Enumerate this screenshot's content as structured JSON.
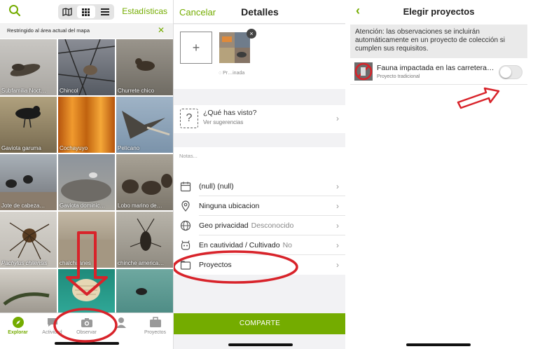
{
  "explore": {
    "stats_link": "Estadísticas",
    "restrict_text": "Restringido al área actual del mapa",
    "tiles": [
      "Subfamilia Noct…",
      "Chincol",
      "Churrete chico",
      "Gaviota garuma",
      "Cochayuyo",
      "Pelícano",
      "Jote de cabeza…",
      "Gaviota dominic…",
      "Lobo marino de…",
      "Pachylus chilensis",
      "chalchuanes",
      "chinche america…",
      "",
      "",
      ""
    ],
    "nav": [
      {
        "label": "Explorar",
        "icon": "explore-icon"
      },
      {
        "label": "Actividad",
        "icon": "activity-icon"
      },
      {
        "label": "Observar",
        "icon": "camera-icon"
      },
      {
        "label": "",
        "icon": "user-icon"
      },
      {
        "label": "Proyectos",
        "icon": "briefcase-icon"
      }
    ]
  },
  "details": {
    "cancel": "Cancelar",
    "title": "Detalles",
    "add_symbol": "+",
    "remove_symbol": "×",
    "thumb_status": "Pr…inada",
    "species_question": "¿Qué has visto?",
    "species_sub": "Ver sugerencias",
    "notes_placeholder": "Notas...",
    "rows": [
      {
        "label": "(null) (null)",
        "value": "",
        "icon": "calendar-icon"
      },
      {
        "label": "Ninguna ubicacion",
        "value": "",
        "icon": "location-pin-icon"
      },
      {
        "label": "Geo privacidad",
        "value": "Desconocido",
        "icon": "globe-icon"
      },
      {
        "label": "En cautividad / Cultivado",
        "value": "No",
        "icon": "captive-icon"
      },
      {
        "label": "Proyectos",
        "value": "",
        "icon": "folder-icon"
      }
    ],
    "share": "COMPARTE"
  },
  "projects": {
    "title": "Elegir proyectos",
    "notice": "Atención: las observaciones se incluirán automáticamente en un proyecto de colección si cumplen sus requisitos.",
    "project_name": "Fauna impactada en las carretera…",
    "project_type": "Proyecto tradicional",
    "toggle_on": false
  },
  "colors": {
    "accent": "#74ac00",
    "annotation": "#d8232a"
  }
}
